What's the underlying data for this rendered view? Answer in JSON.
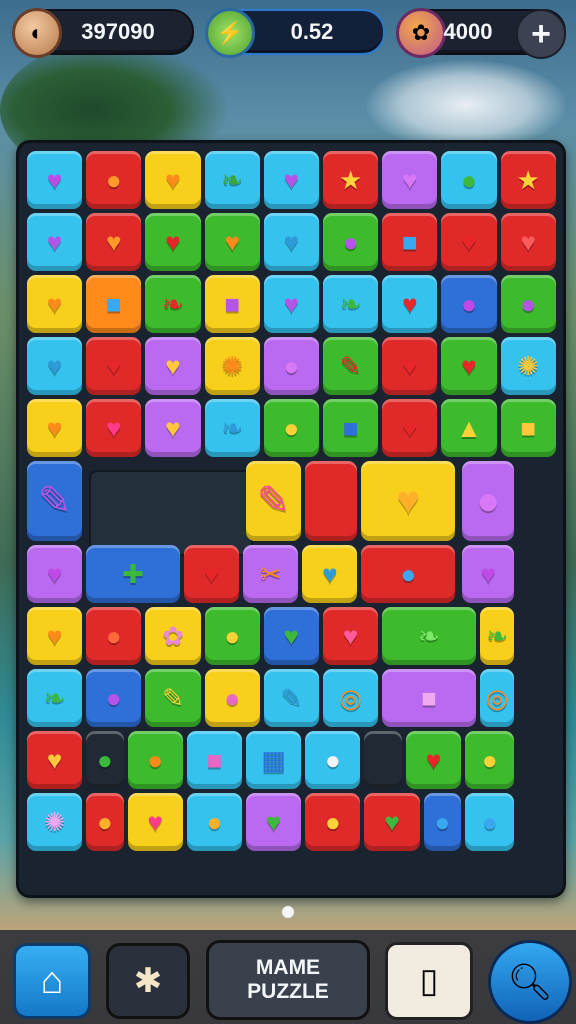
{
  "top_bar": {
    "score": {
      "value": "397090",
      "icon": "cookie-icon"
    },
    "gems": {
      "value": "0.52",
      "icon": "lightning-icon"
    },
    "coins": {
      "value": "4000",
      "icon": "coin-bag-icon",
      "add_label": "+"
    }
  },
  "palette": {
    "p": "#b96af0",
    "c": "#35c2ef",
    "r": "#e02a2a",
    "y": "#f8cf1a",
    "g": "#3dbb2c",
    "o": "#ff8a1c",
    "b": "#2f6fd8",
    "k": "#202a34"
  },
  "tiles": [
    {
      "col": 0,
      "row": 0,
      "w": 1,
      "h": 1,
      "bg": "c",
      "glyph": "♥",
      "glyph_color": "#c04ae8",
      "name": "heart"
    },
    {
      "col": 1,
      "row": 0,
      "w": 1,
      "h": 1,
      "bg": "r",
      "glyph": "●",
      "glyph_color": "#ff9a2a",
      "name": "carrot"
    },
    {
      "col": 2,
      "row": 0,
      "w": 1,
      "h": 1,
      "bg": "y",
      "glyph": "♥",
      "glyph_color": "#ff8a1c",
      "name": "heart"
    },
    {
      "col": 3,
      "row": 0,
      "w": 1,
      "h": 1,
      "bg": "c",
      "glyph": "❧",
      "glyph_color": "#3aa53a",
      "name": "leaf"
    },
    {
      "col": 4,
      "row": 0,
      "w": 1,
      "h": 1,
      "bg": "c",
      "glyph": "♥",
      "glyph_color": "#b455e8",
      "name": "heart"
    },
    {
      "col": 5,
      "row": 0,
      "w": 1,
      "h": 1,
      "bg": "r",
      "glyph": "★",
      "glyph_color": "#ffd23a",
      "name": "star"
    },
    {
      "col": 6,
      "row": 0,
      "w": 1,
      "h": 1,
      "bg": "p",
      "glyph": "♥",
      "glyph_color": "#d878f5",
      "name": "heart"
    },
    {
      "col": 7,
      "row": 0,
      "w": 1,
      "h": 1,
      "bg": "c",
      "glyph": "●",
      "glyph_color": "#3cb83c",
      "name": "pepper"
    },
    {
      "col": 8,
      "row": 0,
      "w": 1,
      "h": 1,
      "bg": "r",
      "glyph": "★",
      "glyph_color": "#ffd23a",
      "name": "star"
    },
    {
      "col": 0,
      "row": 1,
      "w": 1,
      "h": 1,
      "bg": "c",
      "glyph": "♥",
      "glyph_color": "#b455e8",
      "name": "heart"
    },
    {
      "col": 1,
      "row": 1,
      "w": 1,
      "h": 1,
      "bg": "r",
      "glyph": "♥",
      "glyph_color": "#ff9a2a",
      "name": "heart"
    },
    {
      "col": 2,
      "row": 1,
      "w": 1,
      "h": 1,
      "bg": "g",
      "glyph": "♥",
      "glyph_color": "#e8262a",
      "name": "heart"
    },
    {
      "col": 3,
      "row": 1,
      "w": 1,
      "h": 1,
      "bg": "g",
      "glyph": "♥",
      "glyph_color": "#ff8a1c",
      "name": "heart"
    },
    {
      "col": 4,
      "row": 1,
      "w": 1,
      "h": 1,
      "bg": "c",
      "glyph": "♥",
      "glyph_color": "#2f9ad8",
      "name": "heart"
    },
    {
      "col": 5,
      "row": 1,
      "w": 1,
      "h": 1,
      "bg": "g",
      "glyph": "●",
      "glyph_color": "#b455e8",
      "name": "orb"
    },
    {
      "col": 6,
      "row": 1,
      "w": 1,
      "h": 1,
      "bg": "r",
      "glyph": "■",
      "glyph_color": "#3aa8f0",
      "name": "house"
    },
    {
      "col": 7,
      "row": 1,
      "w": 1,
      "h": 1,
      "bg": "r",
      "glyph": "♥",
      "glyph_color": "#e8262a",
      "name": "heart"
    },
    {
      "col": 8,
      "row": 1,
      "w": 1,
      "h": 1,
      "bg": "r",
      "glyph": "♥",
      "glyph_color": "#ff5a5a",
      "name": "heart"
    },
    {
      "col": 0,
      "row": 2,
      "w": 1,
      "h": 1,
      "bg": "y",
      "glyph": "♥",
      "glyph_color": "#ff8a1c",
      "name": "heart"
    },
    {
      "col": 1,
      "row": 2,
      "w": 1,
      "h": 1,
      "bg": "o",
      "glyph": "■",
      "glyph_color": "#3aa8f0",
      "name": "bottle"
    },
    {
      "col": 2,
      "row": 2,
      "w": 1,
      "h": 1,
      "bg": "g",
      "glyph": "❧",
      "glyph_color": "#e8262a",
      "name": "leaf"
    },
    {
      "col": 3,
      "row": 2,
      "w": 1,
      "h": 1,
      "bg": "y",
      "glyph": "■",
      "glyph_color": "#b455e8",
      "name": "panel"
    },
    {
      "col": 4,
      "row": 2,
      "w": 1,
      "h": 1,
      "bg": "c",
      "glyph": "♥",
      "glyph_color": "#b455e8",
      "name": "heart"
    },
    {
      "col": 5,
      "row": 2,
      "w": 1,
      "h": 1,
      "bg": "c",
      "glyph": "❧",
      "glyph_color": "#3cb83c",
      "name": "leaf"
    },
    {
      "col": 6,
      "row": 2,
      "w": 1,
      "h": 1,
      "bg": "c",
      "glyph": "♥",
      "glyph_color": "#e8262a",
      "name": "heart"
    },
    {
      "col": 7,
      "row": 2,
      "w": 1,
      "h": 1,
      "bg": "b",
      "glyph": "●",
      "glyph_color": "#c04ae8",
      "name": "balloon"
    },
    {
      "col": 8,
      "row": 2,
      "w": 1,
      "h": 1,
      "bg": "g",
      "glyph": "●",
      "glyph_color": "#b455e8",
      "name": "eggplant"
    },
    {
      "col": 0,
      "row": 3,
      "w": 1,
      "h": 1,
      "bg": "c",
      "glyph": "♥",
      "glyph_color": "#2f9ad8",
      "name": "heart"
    },
    {
      "col": 1,
      "row": 3,
      "w": 1,
      "h": 1,
      "bg": "r",
      "glyph": "♥",
      "glyph_color": "#e8262a",
      "name": "heart"
    },
    {
      "col": 2,
      "row": 3,
      "w": 1,
      "h": 1,
      "bg": "p",
      "glyph": "♥",
      "glyph_color": "#ffc83a",
      "name": "heart"
    },
    {
      "col": 3,
      "row": 3,
      "w": 1,
      "h": 1,
      "bg": "y",
      "glyph": "✺",
      "glyph_color": "#ff8a1c",
      "name": "sun"
    },
    {
      "col": 4,
      "row": 3,
      "w": 1,
      "h": 1,
      "bg": "p",
      "glyph": "●",
      "glyph_color": "#d878f5",
      "name": "shell"
    },
    {
      "col": 5,
      "row": 3,
      "w": 1,
      "h": 1,
      "bg": "g",
      "glyph": "✎",
      "glyph_color": "#e8262a",
      "name": "pin"
    },
    {
      "col": 6,
      "row": 3,
      "w": 1,
      "h": 1,
      "bg": "r",
      "glyph": "♥",
      "glyph_color": "#e8262a",
      "name": "heart"
    },
    {
      "col": 7,
      "row": 3,
      "w": 1,
      "h": 1,
      "bg": "g",
      "glyph": "♥",
      "glyph_color": "#e8262a",
      "name": "heart"
    },
    {
      "col": 8,
      "row": 3,
      "w": 1,
      "h": 1,
      "bg": "c",
      "glyph": "✺",
      "glyph_color": "#ffc83a",
      "name": "sun"
    },
    {
      "col": 0,
      "row": 4,
      "w": 1,
      "h": 1,
      "bg": "y",
      "glyph": "♥",
      "glyph_color": "#ff8a1c",
      "name": "heart"
    },
    {
      "col": 1,
      "row": 4,
      "w": 1,
      "h": 1,
      "bg": "r",
      "glyph": "♥",
      "glyph_color": "#ff3a8a",
      "name": "heart"
    },
    {
      "col": 2,
      "row": 4,
      "w": 1,
      "h": 1,
      "bg": "p",
      "glyph": "♥",
      "glyph_color": "#ffc83a",
      "name": "heart"
    },
    {
      "col": 3,
      "row": 4,
      "w": 1,
      "h": 1,
      "bg": "c",
      "glyph": "❧",
      "glyph_color": "#2f9ad8",
      "name": "leaf"
    },
    {
      "col": 4,
      "row": 4,
      "w": 1,
      "h": 1,
      "bg": "g",
      "glyph": "●",
      "glyph_color": "#ffd23a",
      "name": "lemon"
    },
    {
      "col": 5,
      "row": 4,
      "w": 1,
      "h": 1,
      "bg": "g",
      "glyph": "■",
      "glyph_color": "#2f6fd8",
      "name": "panel"
    },
    {
      "col": 6,
      "row": 4,
      "w": 1,
      "h": 1,
      "bg": "r",
      "glyph": "♥",
      "glyph_color": "#e8262a",
      "name": "heart"
    },
    {
      "col": 7,
      "row": 4,
      "w": 1,
      "h": 1,
      "bg": "g",
      "glyph": "▲",
      "glyph_color": "#ffd23a",
      "name": "bell"
    },
    {
      "col": 8,
      "row": 4,
      "w": 1,
      "h": 1,
      "bg": "g",
      "glyph": "■",
      "glyph_color": "#ffc83a",
      "name": "panel"
    },
    {
      "col": 0,
      "row": 5,
      "w": 1,
      "h": 1.35,
      "bg": "b",
      "glyph": "✎",
      "glyph_color": "#b455e8",
      "name": "tool"
    },
    {
      "col": 3.7,
      "row": 5,
      "w": 1,
      "h": 1.35,
      "bg": "y",
      "glyph": "✎",
      "glyph_color": "#ff4a9a",
      "name": "tool"
    },
    {
      "col": 4.7,
      "row": 5,
      "w": 0.95,
      "h": 1.35,
      "bg": "r",
      "glyph": "",
      "glyph_color": "#e8262a",
      "name": "block"
    },
    {
      "col": 5.65,
      "row": 5,
      "w": 1.65,
      "h": 1.35,
      "bg": "y",
      "glyph": "♥",
      "glyph_color": "#ffb02a",
      "name": "big-heart"
    },
    {
      "col": 7.35,
      "row": 5,
      "w": 0.95,
      "h": 1.35,
      "bg": "p",
      "glyph": "●",
      "glyph_color": "#d878f5",
      "name": "octopus"
    },
    {
      "col": 0,
      "row": 6.35,
      "w": 1,
      "h": 1,
      "bg": "p",
      "glyph": "♥",
      "glyph_color": "#c04ae8",
      "name": "heart"
    },
    {
      "col": 1,
      "row": 6.35,
      "w": 1.65,
      "h": 1,
      "bg": "b",
      "glyph": "✚",
      "glyph_color": "#3cb83c",
      "name": "cactus"
    },
    {
      "col": 2.65,
      "row": 6.35,
      "w": 1,
      "h": 1,
      "bg": "r",
      "glyph": "♥",
      "glyph_color": "#e8262a",
      "name": "heart"
    },
    {
      "col": 3.65,
      "row": 6.35,
      "w": 1,
      "h": 1,
      "bg": "p",
      "glyph": "✂",
      "glyph_color": "#ff8a1c",
      "name": "scissors"
    },
    {
      "col": 4.65,
      "row": 6.35,
      "w": 1,
      "h": 1,
      "bg": "y",
      "glyph": "♥",
      "glyph_color": "#2f9ad8",
      "name": "heart"
    },
    {
      "col": 5.65,
      "row": 6.35,
      "w": 1.65,
      "h": 1,
      "bg": "r",
      "glyph": "●",
      "glyph_color": "#3aa8f0",
      "name": "ball"
    },
    {
      "col": 7.35,
      "row": 6.35,
      "w": 0.95,
      "h": 1,
      "bg": "p",
      "glyph": "♥",
      "glyph_color": "#c04ae8",
      "name": "heart"
    },
    {
      "col": 0,
      "row": 7.35,
      "w": 1,
      "h": 1,
      "bg": "y",
      "glyph": "♥",
      "glyph_color": "#ff8a1c",
      "name": "heart"
    },
    {
      "col": 1,
      "row": 7.35,
      "w": 1,
      "h": 1,
      "bg": "r",
      "glyph": "●",
      "glyph_color": "#ff6a3a",
      "name": "ball"
    },
    {
      "col": 2,
      "row": 7.35,
      "w": 1,
      "h": 1,
      "bg": "y",
      "glyph": "✿",
      "glyph_color": "#e88ad8",
      "name": "flower"
    },
    {
      "col": 3,
      "row": 7.35,
      "w": 1,
      "h": 1,
      "bg": "g",
      "glyph": "●",
      "glyph_color": "#ffd23a",
      "name": "banana"
    },
    {
      "col": 4,
      "row": 7.35,
      "w": 1,
      "h": 1,
      "bg": "b",
      "glyph": "♥",
      "glyph_color": "#3cb83c",
      "name": "heart"
    },
    {
      "col": 5,
      "row": 7.35,
      "w": 1,
      "h": 1,
      "bg": "r",
      "glyph": "♥",
      "glyph_color": "#ff5a9a",
      "name": "heart"
    },
    {
      "col": 6,
      "row": 7.35,
      "w": 1.65,
      "h": 1,
      "bg": "g",
      "glyph": "❧",
      "glyph_color": "#7ee86a",
      "name": "leaf"
    },
    {
      "col": 7.65,
      "row": 7.35,
      "w": 0.65,
      "h": 1,
      "bg": "y",
      "glyph": "❧",
      "glyph_color": "#3cb83c",
      "name": "leaf"
    },
    {
      "col": 0,
      "row": 8.35,
      "w": 1,
      "h": 1,
      "bg": "c",
      "glyph": "❧",
      "glyph_color": "#3cb83c",
      "name": "leaf"
    },
    {
      "col": 1,
      "row": 8.35,
      "w": 1,
      "h": 1,
      "bg": "b",
      "glyph": "●",
      "glyph_color": "#b455e8",
      "name": "plum"
    },
    {
      "col": 2,
      "row": 8.35,
      "w": 1,
      "h": 1,
      "bg": "g",
      "glyph": "✎",
      "glyph_color": "#ffd23a",
      "name": "tool"
    },
    {
      "col": 3,
      "row": 8.35,
      "w": 1,
      "h": 1,
      "bg": "y",
      "glyph": "●",
      "glyph_color": "#e868c8",
      "name": "candy"
    },
    {
      "col": 4,
      "row": 8.35,
      "w": 1,
      "h": 1,
      "bg": "c",
      "glyph": "✎",
      "glyph_color": "#2f9ad8",
      "name": "tool"
    },
    {
      "col": 5,
      "row": 8.35,
      "w": 1,
      "h": 1,
      "bg": "c",
      "glyph": "◎",
      "glyph_color": "#ff8a1c",
      "name": "ring"
    },
    {
      "col": 6,
      "row": 8.35,
      "w": 1.65,
      "h": 1,
      "bg": "p",
      "glyph": "■",
      "glyph_color": "#f0a8f0",
      "name": "cup"
    },
    {
      "col": 7.65,
      "row": 8.35,
      "w": 0.65,
      "h": 1,
      "bg": "c",
      "glyph": "◎",
      "glyph_color": "#ff8a1c",
      "name": "ring"
    },
    {
      "col": 0,
      "row": 9.35,
      "w": 1,
      "h": 1,
      "bg": "r",
      "glyph": "♥",
      "glyph_color": "#ffc83a",
      "name": "heart"
    },
    {
      "col": 1,
      "row": 9.35,
      "w": 0.7,
      "h": 1,
      "bg": "k",
      "glyph": "●",
      "glyph_color": "#3cb83c",
      "name": "pepper"
    },
    {
      "col": 1.7,
      "row": 9.35,
      "w": 1,
      "h": 1,
      "bg": "g",
      "glyph": "●",
      "glyph_color": "#ff8a1c",
      "name": "ball"
    },
    {
      "col": 2.7,
      "row": 9.35,
      "w": 1,
      "h": 1,
      "bg": "c",
      "glyph": "■",
      "glyph_color": "#e868c8",
      "name": "bag"
    },
    {
      "col": 3.7,
      "row": 9.35,
      "w": 1,
      "h": 1,
      "bg": "c",
      "glyph": "▦",
      "glyph_color": "#2f6fd8",
      "name": "calculator"
    },
    {
      "col": 4.7,
      "row": 9.35,
      "w": 1,
      "h": 1,
      "bg": "c",
      "glyph": "●",
      "glyph_color": "#f0f4fa",
      "name": "surfboard"
    },
    {
      "col": 5.7,
      "row": 9.35,
      "w": 0.7,
      "h": 1,
      "bg": "k",
      "glyph": "",
      "glyph_color": "#202a34",
      "name": "empty"
    },
    {
      "col": 6.4,
      "row": 9.35,
      "w": 1,
      "h": 1,
      "bg": "g",
      "glyph": "♥",
      "glyph_color": "#e8262a",
      "name": "heart"
    },
    {
      "col": 7.4,
      "row": 9.35,
      "w": 0.9,
      "h": 1,
      "bg": "g",
      "glyph": "●",
      "glyph_color": "#ffd23a",
      "name": "banana"
    },
    {
      "col": 0,
      "row": 10.35,
      "w": 1,
      "h": 1,
      "bg": "c",
      "glyph": "✺",
      "glyph_color": "#f0a8f0",
      "name": "flower"
    },
    {
      "col": 1,
      "row": 10.35,
      "w": 0.7,
      "h": 1,
      "bg": "r",
      "glyph": "●",
      "glyph_color": "#ffb02a",
      "name": "carrot"
    },
    {
      "col": 1.7,
      "row": 10.35,
      "w": 1,
      "h": 1,
      "bg": "y",
      "glyph": "♥",
      "glyph_color": "#ff3a8a",
      "name": "heart"
    },
    {
      "col": 2.7,
      "row": 10.35,
      "w": 1,
      "h": 1,
      "bg": "c",
      "glyph": "●",
      "glyph_color": "#ffb02a",
      "name": "ball"
    },
    {
      "col": 3.7,
      "row": 10.35,
      "w": 1,
      "h": 1,
      "bg": "p",
      "glyph": "♥",
      "glyph_color": "#3cb83c",
      "name": "apple"
    },
    {
      "col": 4.7,
      "row": 10.35,
      "w": 1,
      "h": 1,
      "bg": "r",
      "glyph": "●",
      "glyph_color": "#ffd23a",
      "name": "lemon"
    },
    {
      "col": 5.7,
      "row": 10.35,
      "w": 1,
      "h": 1,
      "bg": "r",
      "glyph": "♥",
      "glyph_color": "#3cb83c",
      "name": "heart"
    },
    {
      "col": 6.7,
      "row": 10.35,
      "w": 0.7,
      "h": 1,
      "bg": "b",
      "glyph": "●",
      "glyph_color": "#3aa8f0",
      "name": "pepper"
    },
    {
      "col": 7.4,
      "row": 10.35,
      "w": 0.9,
      "h": 1,
      "bg": "c",
      "glyph": "●",
      "glyph_color": "#3aa8f0",
      "name": "surfboard"
    }
  ],
  "bottom_bar": {
    "home_icon": "home-icon",
    "puzzle_icon": "puzzle-piece-icon",
    "mode_label_1": "MAME",
    "mode_label_2": "PUZZLE",
    "phone_icon": "phone-icon",
    "search_icon": "magnifier-icon"
  }
}
